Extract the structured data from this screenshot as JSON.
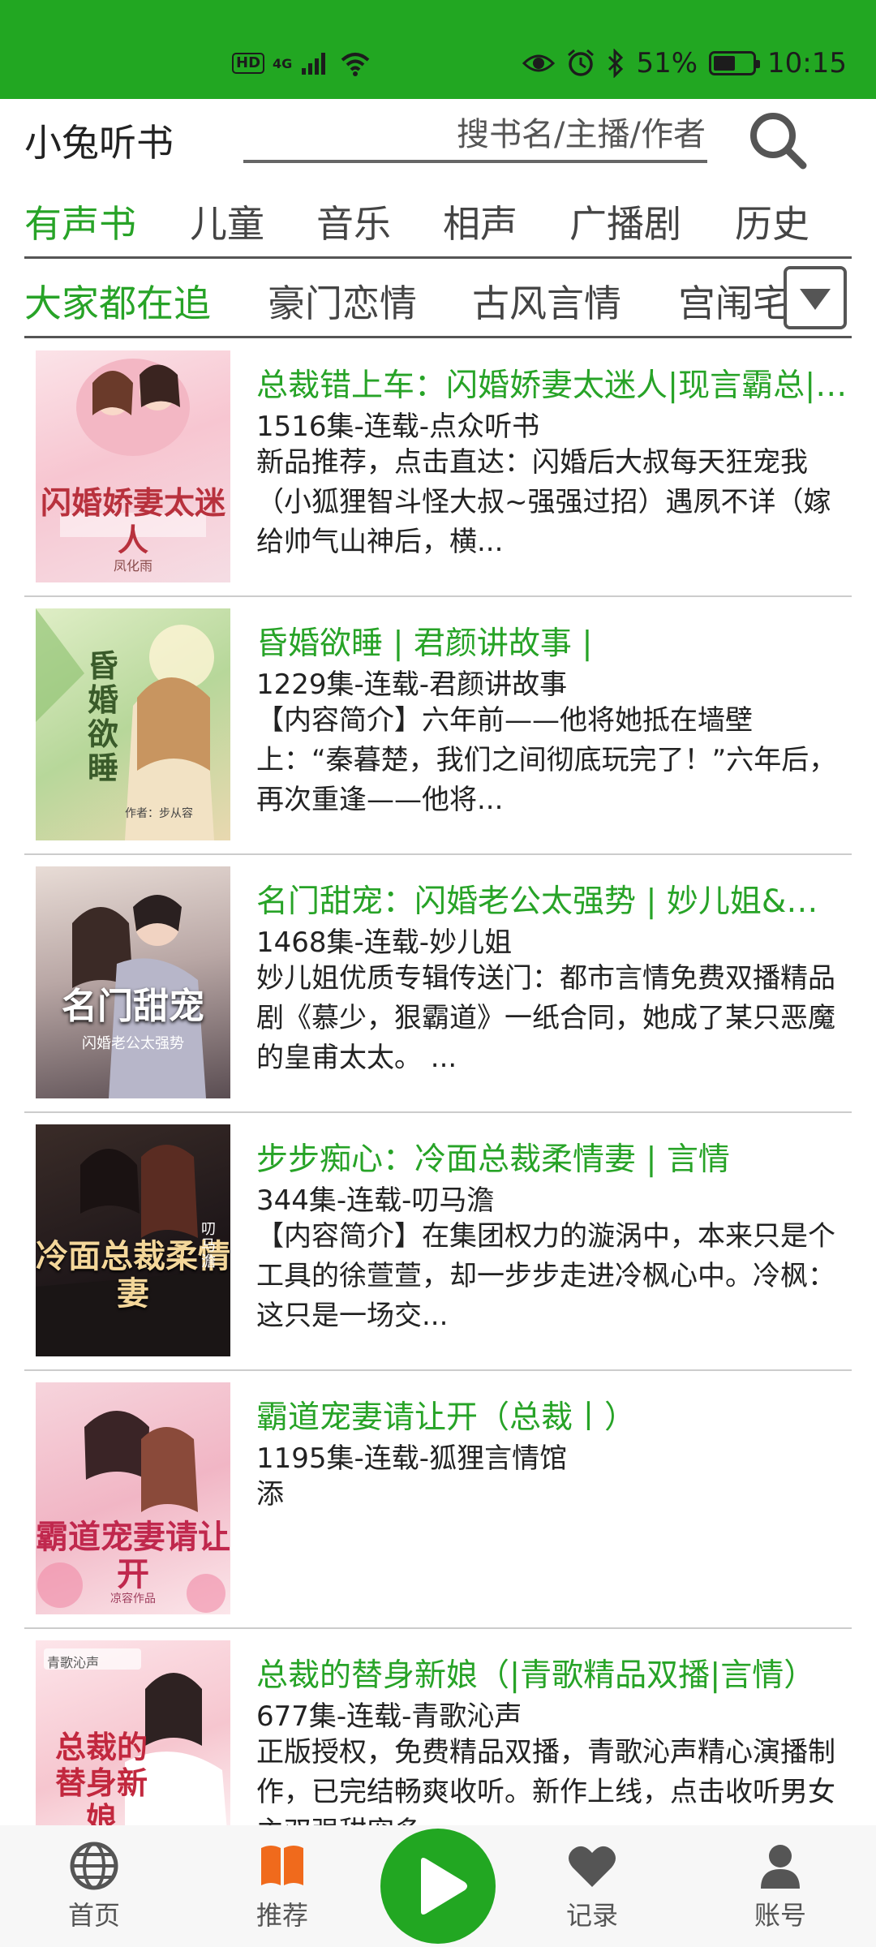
{
  "status_bar": {
    "network": "4G",
    "hd": "HD",
    "battery": "51%",
    "time": "10:15",
    "battery_level": 0.51,
    "background": "#22a722"
  },
  "header": {
    "app_title": "小兔听书",
    "search_placeholder": "搜书名/主播/作者",
    "search_icon": "search-icon"
  },
  "category_tabs": [
    {
      "label": "有声书",
      "active": true
    },
    {
      "label": "儿童",
      "active": false
    },
    {
      "label": "音乐",
      "active": false
    },
    {
      "label": "相声",
      "active": false
    },
    {
      "label": "广播剧",
      "active": false
    },
    {
      "label": "历史",
      "active": false
    }
  ],
  "sub_tabs": [
    {
      "label": "大家都在追",
      "active": true
    },
    {
      "label": "豪门恋情",
      "active": false
    },
    {
      "label": "古风言情",
      "active": false
    },
    {
      "label": "宫闱宅斗",
      "active": false
    }
  ],
  "books": [
    {
      "title": "总裁错上车：闪婚娇妻太迷人|现言霸总|甜宠",
      "meta": "1516集-连载-点众听书",
      "desc": "新品推荐，点击直达：闪婚后大叔每天狂宠我（小狐狸智斗怪大叔~强强过招）遇夙不详（嫁给帅气山神后，横...",
      "cover_text": "闪婚娇妻太迷人",
      "cover_author": "凤化雨"
    },
    {
      "title": "昏婚欲睡 | 君颜讲故事 |",
      "meta": "1229集-连载-君颜讲故事",
      "desc": "【内容简介】六年前——他将她抵在墙壁上：“秦暮楚，我们之间彻底玩完了！”六年后，再次重逢——他将...",
      "cover_text": "昏婚欲睡",
      "cover_author": "作者：步从容"
    },
    {
      "title": "名门甜宠：闪婚老公太强势 | 妙儿姐&晓晓",
      "meta": "1468集-连载-妙儿姐",
      "desc": "妙儿姐优质专辑传送门：都市言情免费双播精品剧《慕少，狠霸道》一纸合同，她成了某只恶魔的皇甫太太。 ...",
      "cover_text": "名门甜宠",
      "cover_author": "闪婚老公太强势"
    },
    {
      "title": "步步痴心：冷面总裁柔情妻 | 言情",
      "meta": "344集-连载-叨马澹",
      "desc": "【内容简介】在集团权力的漩涡中，本来只是个工具的徐萱萱，却一步步走进冷枫心中。冷枫：这只是一场交...",
      "cover_text": "冷面总裁柔情妻",
      "cover_author": "叨马澹"
    },
    {
      "title": "霸道宠妻请让开（总裁丨）",
      "meta": "1195集-连载-狐狸言情馆",
      "desc": "添",
      "cover_text": "霸道宠妻请让开",
      "cover_author": "凉容作品"
    },
    {
      "title": "总裁的替身新娘（|青歌精品双播|言情）",
      "meta": "677集-连载-青歌沁声",
      "desc": "正版授权，免费精品双播，青歌沁声精心演播制作，已完结畅爽收听。新作上线，点击收听男女主双强甜宠多...",
      "cover_text": "总裁的替身新娘",
      "cover_author": "青歌沁声"
    }
  ],
  "bottom_nav": {
    "items": [
      {
        "label": "首页",
        "icon": "globe-icon"
      },
      {
        "label": "推荐",
        "icon": "book-icon"
      },
      {
        "label": "记录",
        "icon": "heart-icon"
      },
      {
        "label": "账号",
        "icon": "user-icon"
      }
    ],
    "play_icon": "play-icon"
  },
  "colors": {
    "accent": "#27a327",
    "status_bar": "#22a722",
    "recommend_icon": "#f06a1c"
  }
}
